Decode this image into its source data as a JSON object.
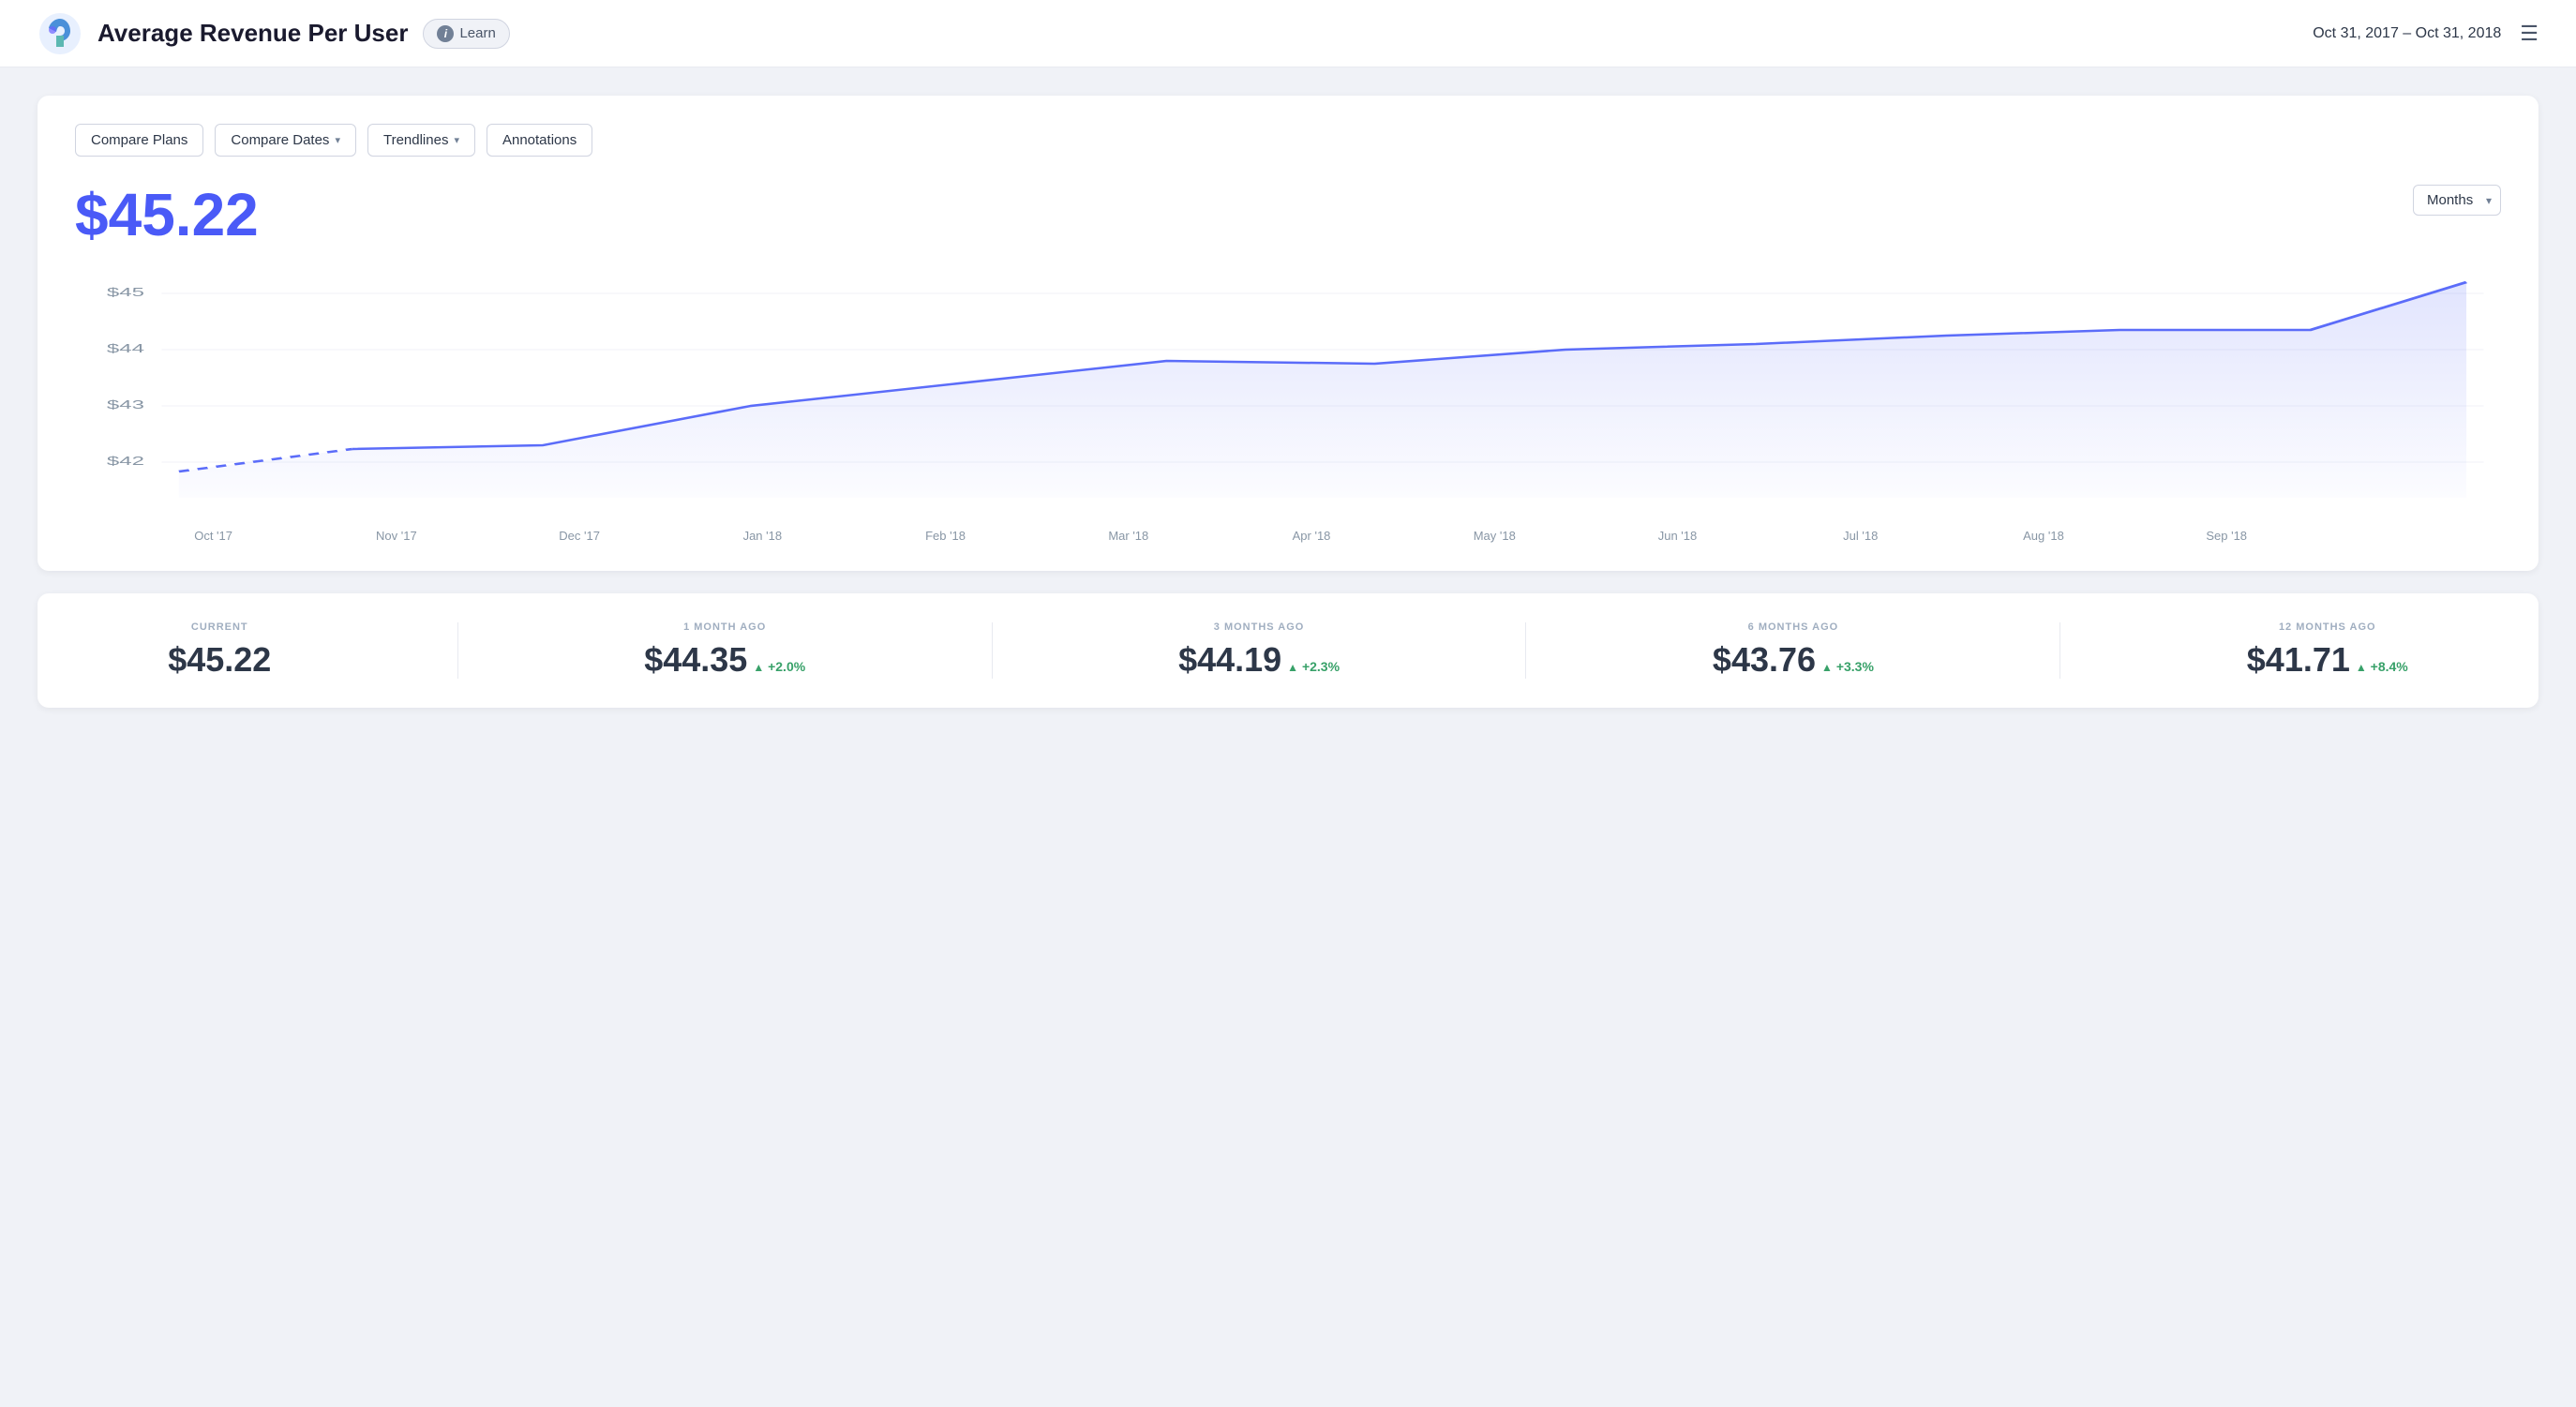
{
  "header": {
    "title": "Average Revenue Per User",
    "learn_label": "Learn",
    "date_range": "Oct 31, 2017  –  Oct 31, 2018"
  },
  "toolbar": {
    "compare_plans": "Compare Plans",
    "compare_dates": "Compare Dates",
    "trendlines": "Trendlines",
    "annotations": "Annotations"
  },
  "chart": {
    "main_value": "$45.22",
    "granularity": "Months",
    "y_labels": [
      "$45",
      "$44",
      "$43",
      "$42"
    ],
    "x_labels": [
      "Oct '17",
      "Nov '17",
      "Dec '17",
      "Jan '18",
      "Feb '18",
      "Mar '18",
      "Apr '18",
      "May '18",
      "Jun '18",
      "Jul '18",
      "Aug '18",
      "Sep '18",
      ""
    ]
  },
  "stats": [
    {
      "label": "CURRENT",
      "value": "$45.22",
      "change": null
    },
    {
      "label": "1 MONTH AGO",
      "value": "$44.35",
      "change": "+2.0%"
    },
    {
      "label": "3 MONTHS AGO",
      "value": "$44.19",
      "change": "+2.3%"
    },
    {
      "label": "6 MONTHS AGO",
      "value": "$43.76",
      "change": "+3.3%"
    },
    {
      "label": "12 MONTHS AGO",
      "value": "$41.71",
      "change": "+8.4%"
    }
  ]
}
